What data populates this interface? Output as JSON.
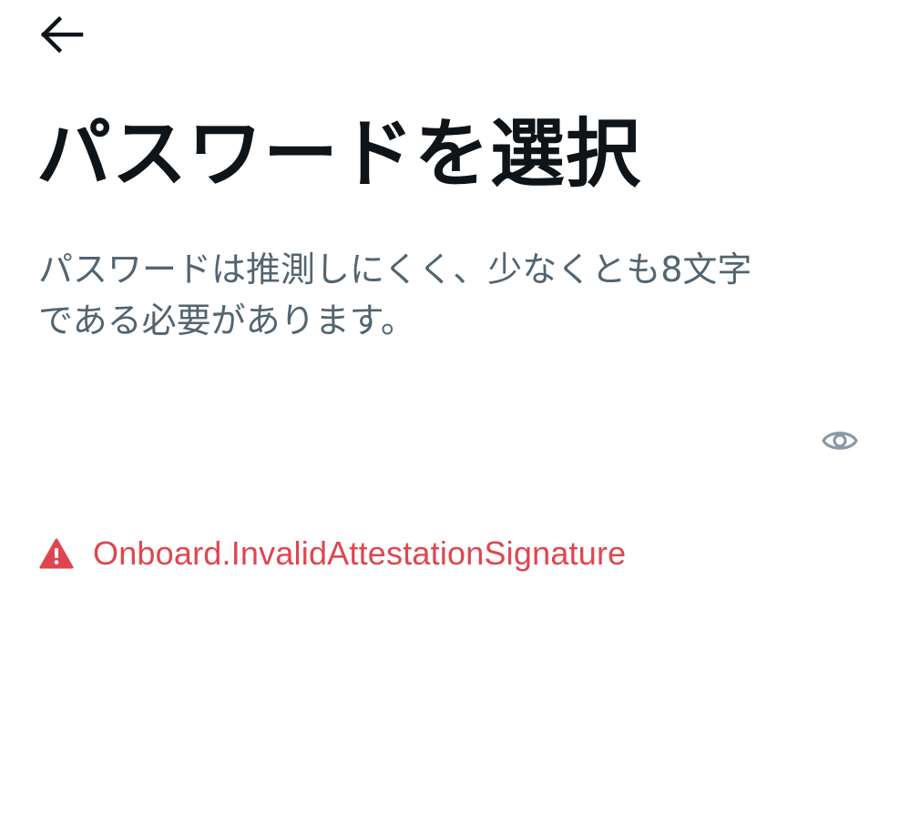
{
  "header": {
    "back_icon": "arrow-left-icon"
  },
  "title": "パスワードを選択",
  "subtitle": {
    "line1": "パスワードは推測しにくく、少なくとも8文字",
    "line2": "である必要があります。"
  },
  "password_field": {
    "value": "",
    "placeholder": "",
    "toggle_icon": "eye-icon"
  },
  "error": {
    "icon": "warning-triangle-icon",
    "message": "Onboard.InvalidAttestationSignature",
    "color": "#e0454f"
  },
  "colors": {
    "title": "#0f1419",
    "subtitle": "#536471",
    "icon_gray": "#8b98a5"
  }
}
